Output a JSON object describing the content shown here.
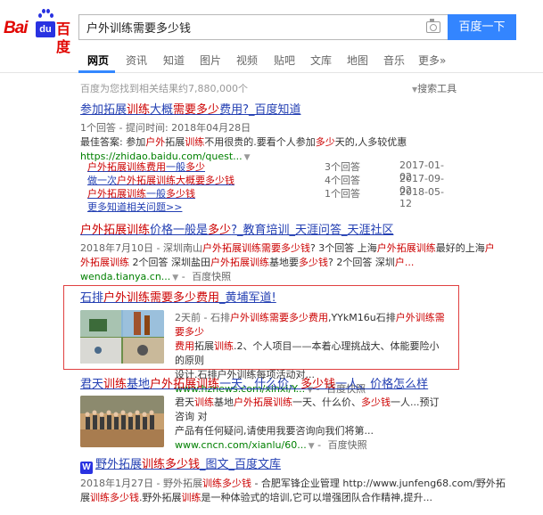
{
  "header": {
    "logo_bai": "Bai",
    "logo_du": "du",
    "logo_cn": "百度",
    "query": "户外训练需要多少钱",
    "search_button": "百度一下"
  },
  "tabs": [
    {
      "label": "网页",
      "active": true
    },
    {
      "label": "资讯"
    },
    {
      "label": "知道"
    },
    {
      "label": "图片"
    },
    {
      "label": "视频"
    },
    {
      "label": "贴吧"
    },
    {
      "label": "文库"
    },
    {
      "label": "地图"
    },
    {
      "label": "音乐"
    },
    {
      "label": "更多»"
    }
  ],
  "meta": {
    "result_count": "百度为您找到相关结果约7,880,000个",
    "search_tools": "搜索工具"
  },
  "results": [
    {
      "title_parts": [
        "参加拓展",
        "训练",
        "大概",
        "需要多少",
        "费用?_百度知道"
      ],
      "line1": "1个回答 - 提问时间: 2018年04月28日",
      "line2_prefix": "最佳答案: 参加",
      "line2_parts": [
        "户外",
        "拓展",
        "训练",
        "不用很贵的.要看个人参加",
        "多少",
        "天的,人多较优惠"
      ],
      "url": "https://zhidao.baidu.com/quest...",
      "qa": [
        {
          "q_parts": [
            "户外",
            "拓展",
            "训练费用",
            "一般",
            "多少"
          ],
          "answers": "3个回答",
          "date": "2017-01-02"
        },
        {
          "q_parts": [
            "做一次",
            "户外",
            "拓展",
            "训练大概",
            "要",
            "多少",
            "钱"
          ],
          "answers": "4个回答",
          "date": "2017-09-02"
        },
        {
          "q_parts": [
            "户外",
            "拓展",
            "训练",
            "一般",
            "多少",
            "钱"
          ],
          "answers": "1个回答",
          "date": "2018-05-12"
        }
      ],
      "more": "更多知道相关问题>>"
    },
    {
      "title_parts": [
        "户外",
        "拓展",
        "训练",
        "价格一般是",
        "多少",
        "?_教育培训_天涯问答_天涯社区"
      ],
      "line1_parts": [
        "2018年7月10日 - 深圳南山",
        "户外",
        "拓展",
        "训练",
        "需要多少钱",
        "? 3个回答 上海",
        "户外",
        "拓展",
        "训练",
        "最好的上海",
        "户"
      ],
      "line2_parts": [
        "外",
        "拓展",
        "训练",
        " 2个回答 深圳盐田",
        "户外",
        "拓展",
        "训练",
        "基地要",
        "多少钱",
        "? 2个回答 深圳",
        "户..."
      ],
      "url": "wenda.tianya.cn...",
      "snap": "百度快照"
    },
    {
      "title_parts": [
        "石排",
        "户外训练需要多少费用",
        "_黄埔军道!"
      ],
      "line1_parts": [
        "2天前 - 石排",
        "户外训练需要多少费用",
        ",YYkM16u石排",
        "户外训练需要多少"
      ],
      "line2_parts": [
        "费用",
        "拓展",
        "训练",
        ".2、个人项目——本着心理挑战大、体能要险小的原则"
      ],
      "line3": "设计.石排户外训练每项活动对...",
      "url": "www.hznews.com/xinxi/Y...",
      "snap": "百度快照"
    },
    {
      "title_parts": [
        "君天",
        "训练",
        "基地",
        "户外",
        "拓展",
        "训练",
        "一天、什么价、",
        "多少钱",
        "一人、价格怎么样"
      ],
      "line1_parts": [
        "君天",
        "训练",
        "基地",
        "户外",
        "拓展",
        "训练",
        "一天、什么价、",
        "多少钱",
        "一人...预订咨询 对"
      ],
      "line2": "产品有任何疑问,请使用我要咨询向我们将第...",
      "url": "www.cncn.com/xianlu/60...",
      "snap": "百度快照"
    },
    {
      "wenku": "W",
      "title_parts": [
        "野外拓展",
        "训练多少钱",
        "_图文_百度文库"
      ],
      "line1_parts": [
        "2018年1月27日 - 野外拓展",
        "训练多少钱",
        " - 合肥军锋企业管理 http://www.junfeng68.com/野外拓"
      ],
      "line2_parts": [
        "展",
        "训练多少钱",
        ".野外拓展",
        "训练",
        "是一种体验式的培训,它可以增强团队合作精神,提升..."
      ]
    }
  ]
}
